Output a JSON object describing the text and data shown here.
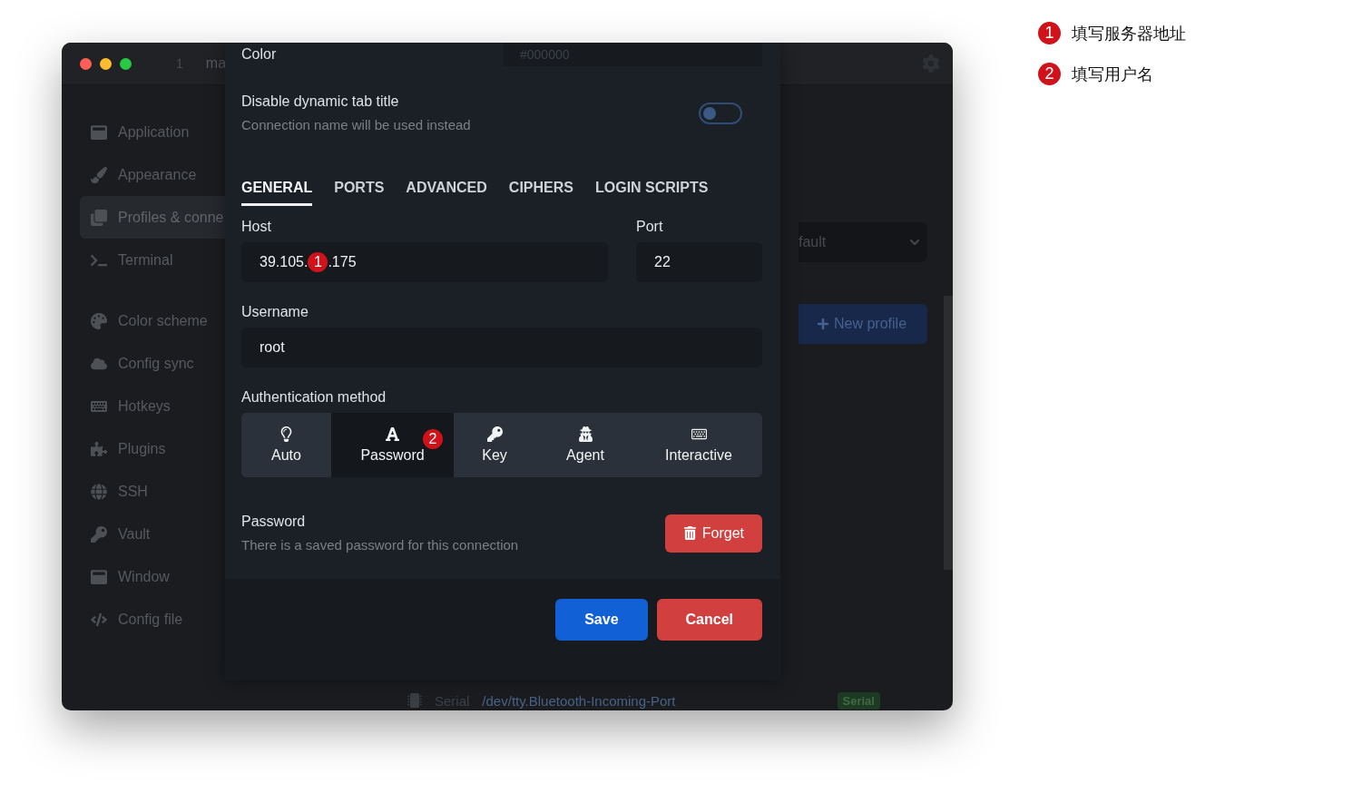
{
  "window": {
    "tab_number": "1",
    "tab_title": "ma"
  },
  "sidebar": {
    "groups": [
      [
        {
          "label": "Application",
          "selected": false
        },
        {
          "label": "Appearance",
          "selected": false
        },
        {
          "label": "Profiles & conne",
          "selected": true
        },
        {
          "label": "Terminal",
          "selected": false
        }
      ],
      [
        {
          "label": "Color scheme",
          "selected": false
        },
        {
          "label": "Config sync",
          "selected": false
        },
        {
          "label": "Hotkeys",
          "selected": false
        },
        {
          "label": "Plugins",
          "selected": false
        },
        {
          "label": "SSH",
          "selected": false
        },
        {
          "label": "Vault",
          "selected": false
        },
        {
          "label": "Window",
          "selected": false
        },
        {
          "label": "Config file",
          "selected": false
        }
      ]
    ]
  },
  "background": {
    "dropdown_value": "fault",
    "new_profile_button": "New profile",
    "list_row": {
      "name": "Serial",
      "path": "/dev/tty.Bluetooth-Incoming-Port",
      "badge": "Serial"
    }
  },
  "dialog": {
    "color": {
      "label": "Color",
      "placeholder": "#000000"
    },
    "dynamic_title": {
      "label": "Disable dynamic tab title",
      "hint": "Connection name will be used instead",
      "on": false
    },
    "tabs": [
      {
        "label": "GENERAL",
        "selected": true
      },
      {
        "label": "PORTS",
        "selected": false
      },
      {
        "label": "ADVANCED",
        "selected": false
      },
      {
        "label": "CIPHERS",
        "selected": false
      },
      {
        "label": "LOGIN SCRIPTS",
        "selected": false
      }
    ],
    "host": {
      "label": "Host",
      "value_start": "39.105.",
      "value_end": ".175",
      "marker": "1"
    },
    "port": {
      "label": "Port",
      "value": "22"
    },
    "username": {
      "label": "Username",
      "value": "root"
    },
    "auth": {
      "label": "Authentication method",
      "methods": [
        {
          "label": "Auto",
          "selected": false
        },
        {
          "label": "Password",
          "selected": true,
          "marker": "2"
        },
        {
          "label": "Key",
          "selected": false
        },
        {
          "label": "Agent",
          "selected": false
        },
        {
          "label": "Interactive",
          "selected": false
        }
      ]
    },
    "password": {
      "label": "Password",
      "hint": "There is a saved password for this connection",
      "forget_button": "Forget"
    },
    "buttons": [
      {
        "label": "Save",
        "kind": "primary"
      },
      {
        "label": "Cancel",
        "kind": "danger"
      }
    ]
  },
  "annotations": [
    {
      "number": "1",
      "text": "填写服务器地址"
    },
    {
      "number": "2",
      "text": "填写用户名"
    }
  ]
}
